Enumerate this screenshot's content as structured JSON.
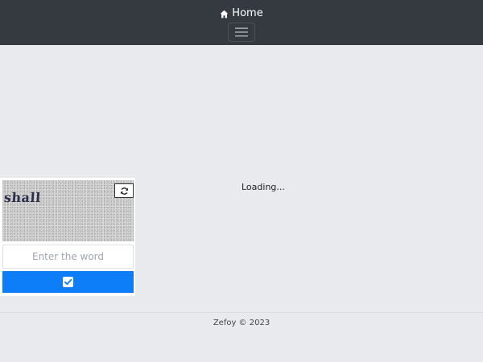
{
  "navbar": {
    "brand_label": "Home",
    "brand_icon": "home-icon",
    "toggler_icon": "hamburger-icon",
    "background": "#343a40"
  },
  "main": {
    "loading_text": "Loading..."
  },
  "captcha": {
    "word": "shall",
    "refresh_icon": "refresh-icon",
    "input_placeholder": "Enter the word",
    "input_value": "",
    "submit_icon": "check-square-icon",
    "submit_color": "#0d7ef7"
  },
  "footer": {
    "text": "Zefoy © 2023"
  }
}
